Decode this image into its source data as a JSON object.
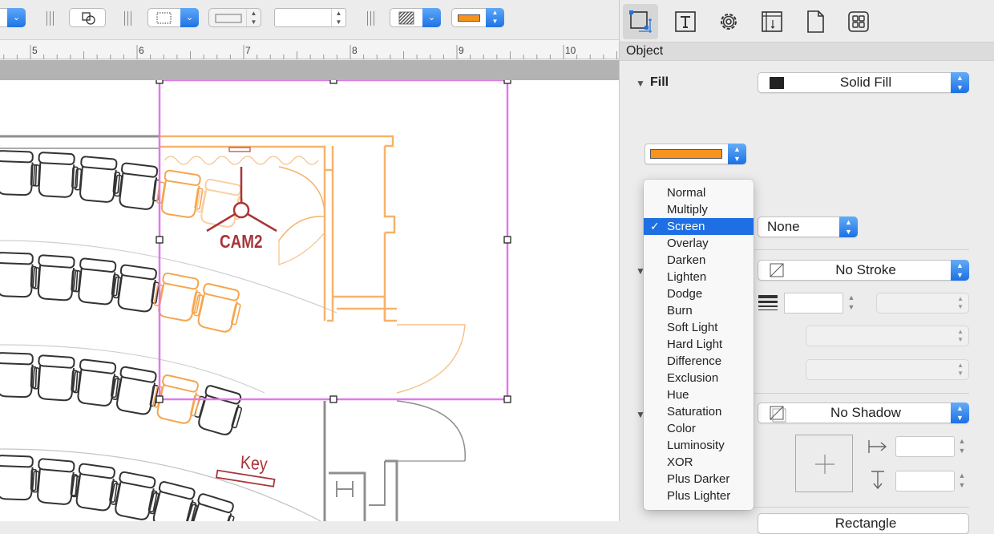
{
  "toolbar": {
    "opacity_value": "",
    "pattern_icon": "hatch-pattern-icon",
    "accent_color": "#1f73e4",
    "fill_swatch_color": "#f7941d"
  },
  "ruler": {
    "labels": [
      "5",
      "6",
      "7",
      "8",
      "9",
      "10"
    ]
  },
  "canvas": {
    "cam_label": "CAM2",
    "key_label": "Key",
    "selection_color": "#e07ae8",
    "highlight_color": "#f6b36b",
    "label_color": "#a8353a"
  },
  "inspector": {
    "section_title": "Object",
    "fill": {
      "label": "Fill",
      "type": "Solid Fill",
      "swatch_color": "#f7941d",
      "blend_menu": {
        "items": [
          "Normal",
          "Multiply",
          "Screen",
          "Overlay",
          "Darken",
          "Lighten",
          "Dodge",
          "Burn",
          "Soft Light",
          "Hard Light",
          "Difference",
          "Exclusion",
          "Hue",
          "Saturation",
          "Color",
          "Luminosity",
          "XOR",
          "Plus Darker",
          "Plus Lighter"
        ],
        "selected": "Screen",
        "check": "✓"
      },
      "secondary_popup": "None"
    },
    "stroke": {
      "type": "No Stroke"
    },
    "shadow": {
      "type": "No Shadow"
    },
    "next_popup_partial": "Rectangle"
  }
}
